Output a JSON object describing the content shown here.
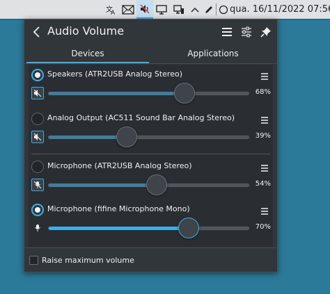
{
  "panel": {
    "clock": "qua. 16/11/2022 07:56",
    "tray_icons": [
      "translate-icon",
      "mail-icon",
      "speaker-muted-icon",
      "display-icon",
      "network-icon",
      "chevron-up-icon",
      "pen-icon",
      "circle-icon"
    ]
  },
  "popup": {
    "title": "Audio Volume",
    "tabs": [
      {
        "label": "Devices",
        "active": true
      },
      {
        "label": "Applications",
        "active": false
      }
    ],
    "devices": [
      {
        "name": "Speakers (ATR2USB Analog Stereo)",
        "volume": 68,
        "volume_label": "68%",
        "default": true,
        "muted": true
      },
      {
        "name": "Analog Output (AC511 Sound Bar Analog Stereo)",
        "volume": 39,
        "volume_label": "39%",
        "default": false,
        "muted": true
      },
      {
        "name": "Microphone (ATR2USB Analog Stereo)",
        "volume": 54,
        "volume_label": "54%",
        "default": false,
        "muted": true
      },
      {
        "name": "Microphone (fifine Microphone Mono)",
        "volume": 70,
        "volume_label": "70%",
        "default": true,
        "muted": false
      }
    ],
    "raise_max_label": "Raise maximum volume",
    "raise_max_checked": false
  },
  "colors": {
    "accent": "#3daee9",
    "popup_bg": "#31363b",
    "desktop_bg": "#2c7a9a"
  }
}
